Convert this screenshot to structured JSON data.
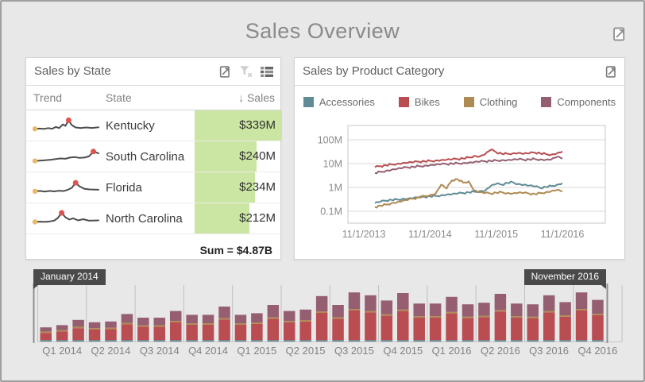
{
  "dashboard": {
    "title": "Sales Overview"
  },
  "colors": {
    "background": "#e8e8e8",
    "card_background": "#ffffff",
    "card_border": "#d4d4d4",
    "databar_green": "#cbe5a2",
    "spark_line": "#4d4d4d",
    "spark_start_dot": "#e9b86a",
    "spark_max_dot": "#dd5450",
    "tooltip_background": "#4a4a4a",
    "accessories": "#5f8b95",
    "bikes": "#ba4d51",
    "clothing": "#af8a53",
    "components": "#955f71"
  },
  "sales_by_state": {
    "title": "Sales by State",
    "columns": {
      "trend": "Trend",
      "state": "State",
      "sales": "Sales",
      "sort_indicator": "↓"
    },
    "rows": [
      {
        "state": "Kentucky",
        "sales": "$339M",
        "value": 339,
        "spark": [
          [
            0,
            0.75
          ],
          [
            0.07,
            0.73
          ],
          [
            0.14,
            0.75
          ],
          [
            0.21,
            0.7
          ],
          [
            0.27,
            0.74
          ],
          [
            0.33,
            0.62
          ],
          [
            0.38,
            0.7
          ],
          [
            0.44,
            0.45
          ],
          [
            0.48,
            0.55
          ],
          [
            0.53,
            0.18
          ],
          [
            0.58,
            0.5
          ],
          [
            0.64,
            0.66
          ],
          [
            0.72,
            0.7
          ],
          [
            0.8,
            0.66
          ],
          [
            0.9,
            0.69
          ],
          [
            1,
            0.64
          ]
        ]
      },
      {
        "state": "South Carolina",
        "sales": "$240M",
        "value": 240,
        "spark": [
          [
            0,
            0.82
          ],
          [
            0.08,
            0.8
          ],
          [
            0.16,
            0.78
          ],
          [
            0.25,
            0.74
          ],
          [
            0.33,
            0.7
          ],
          [
            0.4,
            0.66
          ],
          [
            0.48,
            0.68
          ],
          [
            0.55,
            0.6
          ],
          [
            0.63,
            0.57
          ],
          [
            0.7,
            0.62
          ],
          [
            0.78,
            0.6
          ],
          [
            0.85,
            0.52
          ],
          [
            0.92,
            0.2
          ],
          [
            1,
            0.32
          ]
        ]
      },
      {
        "state": "Florida",
        "sales": "$234M",
        "value": 234,
        "spark": [
          [
            0,
            0.78
          ],
          [
            0.08,
            0.76
          ],
          [
            0.15,
            0.8
          ],
          [
            0.23,
            0.76
          ],
          [
            0.3,
            0.79
          ],
          [
            0.38,
            0.74
          ],
          [
            0.45,
            0.77
          ],
          [
            0.52,
            0.68
          ],
          [
            0.58,
            0.55
          ],
          [
            0.64,
            0.22
          ],
          [
            0.7,
            0.45
          ],
          [
            0.78,
            0.62
          ],
          [
            0.86,
            0.66
          ],
          [
            1,
            0.68
          ]
        ]
      },
      {
        "state": "North Carolina",
        "sales": "$212M",
        "value": 212,
        "spark": [
          [
            0,
            0.76
          ],
          [
            0.08,
            0.74
          ],
          [
            0.16,
            0.76
          ],
          [
            0.24,
            0.72
          ],
          [
            0.3,
            0.68
          ],
          [
            0.36,
            0.5
          ],
          [
            0.42,
            0.16
          ],
          [
            0.48,
            0.45
          ],
          [
            0.54,
            0.6
          ],
          [
            0.6,
            0.52
          ],
          [
            0.68,
            0.66
          ],
          [
            0.76,
            0.58
          ],
          [
            0.85,
            0.68
          ],
          [
            1,
            0.66
          ]
        ]
      }
    ],
    "summary": "Sum = $4.87B"
  },
  "sales_by_category": {
    "title": "Sales by Product Category"
  },
  "chart_data": [
    {
      "type": "line",
      "title": "Sales by Product Category",
      "y_scale": "log",
      "grid": true,
      "legend_position": "top",
      "y_ticks": [
        "100M",
        "10M",
        "1M",
        "0.1M"
      ],
      "y_tick_values": [
        100,
        10,
        1,
        0.1
      ],
      "ylim_millions": [
        0.03,
        400
      ],
      "x_ticks": [
        "11/1/2013",
        "11/1/2014",
        "11/1/2015",
        "11/1/2016"
      ],
      "x_tick_month_offsets": [
        -2,
        10,
        22,
        34
      ],
      "x": [
        "2014-01",
        "2014-02",
        "2014-03",
        "2014-04",
        "2014-05",
        "2014-06",
        "2014-07",
        "2014-08",
        "2014-09",
        "2014-10",
        "2014-11",
        "2014-12",
        "2015-01",
        "2015-02",
        "2015-03",
        "2015-04",
        "2015-05",
        "2015-06",
        "2015-07",
        "2015-08",
        "2015-09",
        "2015-10",
        "2015-11",
        "2015-12",
        "2016-01",
        "2016-02",
        "2016-03",
        "2016-04",
        "2016-05",
        "2016-06",
        "2016-07",
        "2016-08",
        "2016-09",
        "2016-10",
        "2016-11"
      ],
      "unit": "millions USD (estimated from log axis)",
      "series": [
        {
          "name": "Accessories",
          "color": "#5f8b95",
          "values": [
            0.22,
            0.25,
            0.28,
            0.3,
            0.31,
            0.33,
            0.34,
            0.36,
            0.38,
            0.4,
            0.42,
            0.44,
            0.47,
            0.5,
            0.52,
            0.55,
            0.58,
            0.62,
            0.66,
            0.7,
            0.74,
            1.15,
            1.4,
            1.3,
            1.55,
            1.65,
            1.4,
            1.3,
            1.2,
            1.1,
            0.95,
            1.05,
            1.15,
            1.3,
            1.5
          ]
        },
        {
          "name": "Bikes",
          "color": "#ba4d51",
          "values": [
            7,
            7.8,
            8.5,
            9.2,
            9.8,
            10.5,
            11,
            11.5,
            12,
            12.5,
            13,
            13.5,
            14,
            14.5,
            15,
            15.5,
            16.5,
            18,
            21,
            20,
            25,
            38,
            30,
            26,
            26,
            27,
            28,
            26,
            27,
            29,
            27,
            25,
            24,
            27,
            32
          ]
        },
        {
          "name": "Clothing",
          "color": "#af8a53",
          "values": [
            0.15,
            0.17,
            0.19,
            0.22,
            0.24,
            0.27,
            0.3,
            0.34,
            0.38,
            0.43,
            0.48,
            0.55,
            1.3,
            0.9,
            2.0,
            2.2,
            1.6,
            1.8,
            0.75,
            0.62,
            0.58,
            0.55,
            0.6,
            0.63,
            0.58,
            0.56,
            0.6,
            0.58,
            0.55,
            0.52,
            0.58,
            0.63,
            0.7,
            0.78,
            0.68
          ]
        },
        {
          "name": "Components",
          "color": "#955f71",
          "values": [
            4,
            4.5,
            5,
            5.5,
            6,
            6.5,
            7,
            7.3,
            7.8,
            8.2,
            8.6,
            9,
            9.3,
            9.6,
            10,
            10.3,
            10.6,
            11,
            11.5,
            12,
            12.5,
            13,
            13.5,
            14,
            14,
            14.5,
            15,
            14.5,
            15,
            15.5,
            15,
            14.5,
            15,
            19,
            16
          ]
        }
      ]
    },
    {
      "type": "bar",
      "stacked": true,
      "role": "range-selector",
      "selection": {
        "start": "January 2014",
        "end": "November 2016"
      },
      "quarter_labels": [
        "Q1 2014",
        "Q2 2014",
        "Q3 2014",
        "Q4 2014",
        "Q1 2015",
        "Q2 2015",
        "Q3 2015",
        "Q4 2015",
        "Q1 2016",
        "Q2 2016",
        "Q3 2016",
        "Q4 2016"
      ],
      "x": [
        "2014-01",
        "2014-02",
        "2014-03",
        "2014-04",
        "2014-05",
        "2014-06",
        "2014-07",
        "2014-08",
        "2014-09",
        "2014-10",
        "2014-11",
        "2014-12",
        "2015-01",
        "2015-02",
        "2015-03",
        "2015-04",
        "2015-05",
        "2015-06",
        "2015-07",
        "2015-08",
        "2015-09",
        "2015-10",
        "2015-11",
        "2015-12",
        "2016-01",
        "2016-02",
        "2016-03",
        "2016-04",
        "2016-05",
        "2016-06",
        "2016-07",
        "2016-08",
        "2016-09",
        "2016-10",
        "2016-11"
      ],
      "unit": "millions USD (estimated from bar heights)",
      "series": [
        {
          "name": "Accessories",
          "color": "#5f8b95",
          "values": [
            2,
            3,
            4,
            3,
            3,
            5,
            4,
            4,
            6,
            5,
            5,
            6,
            5,
            5,
            7,
            6,
            6,
            9,
            7,
            9,
            9,
            8,
            9,
            7,
            7,
            8,
            7,
            7,
            9,
            7,
            7,
            9,
            7,
            9,
            8
          ]
        },
        {
          "name": "Bikes",
          "color": "#ba4d51",
          "values": [
            45,
            54,
            75,
            66,
            69,
            99,
            84,
            84,
            111,
            96,
            96,
            129,
            96,
            102,
            135,
            111,
            117,
            171,
            135,
            186,
            174,
            153,
            183,
            141,
            141,
            168,
            138,
            144,
            180,
            141,
            138,
            174,
            147,
            186,
            156
          ]
        },
        {
          "name": "Clothing",
          "color": "#af8a53",
          "values": [
            2,
            3,
            4,
            3,
            3,
            5,
            4,
            4,
            6,
            5,
            5,
            6,
            5,
            5,
            7,
            6,
            6,
            9,
            7,
            9,
            9,
            8,
            9,
            7,
            7,
            8,
            7,
            7,
            9,
            7,
            7,
            9,
            7,
            9,
            8
          ]
        },
        {
          "name": "Components",
          "color": "#955f71",
          "values": [
            26,
            31,
            43,
            37,
            39,
            56,
            48,
            48,
            63,
            54,
            54,
            73,
            54,
            58,
            77,
            63,
            66,
            97,
            77,
            105,
            99,
            87,
            104,
            80,
            80,
            95,
            78,
            82,
            102,
            80,
            78,
            99,
            83,
            105,
            88
          ]
        }
      ]
    }
  ]
}
